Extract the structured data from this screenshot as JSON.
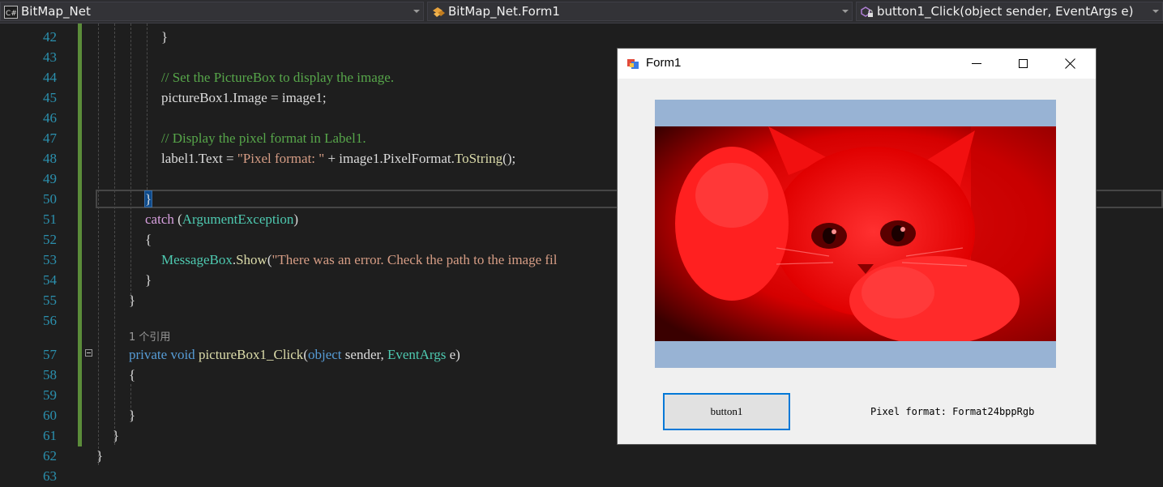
{
  "navigation_bar": {
    "project": {
      "label": "BitMap_Net",
      "icon": "csharp-project-icon"
    },
    "class": {
      "label": "BitMap_Net.Form1",
      "icon": "class-icon"
    },
    "member": {
      "label": "button1_Click(object sender, EventArgs e)",
      "icon": "method-lock-icon"
    }
  },
  "editor": {
    "line_numbers": [
      "42",
      "43",
      "44",
      "45",
      "46",
      "47",
      "48",
      "49",
      "50",
      "51",
      "52",
      "53",
      "54",
      "55",
      "56",
      "57",
      "58",
      "59",
      "60",
      "61",
      "62",
      "63"
    ],
    "codelens": "1 个引用",
    "code": {
      "l42": "}",
      "l44_comment": "// Set the PictureBox to display the image.",
      "l45": "pictureBox1.Image = image1;",
      "l47_comment": "// Display the pixel format in Label1.",
      "l48_a": "label1.Text = ",
      "l48_str": "\"Pixel format: \"",
      "l48_b": " + image1.PixelFormat.",
      "l48_meth": "ToString",
      "l48_c": "();",
      "l50": "}",
      "l51_kw": "catch",
      "l51_a": " (",
      "l51_type": "ArgumentException",
      "l51_b": ")",
      "l52": "{",
      "l53_type": "MessageBox",
      "l53_a": ".",
      "l53_meth": "Show",
      "l53_b": "(",
      "l53_str": "\"There was an error. Check the path to the image fil",
      "l54": "}",
      "l55": "}",
      "l57_kw1": "private",
      "l57_kw2": "void",
      "l57_meth": "pictureBox1_Click",
      "l57_a": "(",
      "l57_kw3": "object",
      "l57_b": " sender, ",
      "l57_type": "EventArgs",
      "l57_c": " e)",
      "l58": "{",
      "l60": "}",
      "l61": "}",
      "l62": "}"
    }
  },
  "form": {
    "title": "Form1",
    "icon": "form-app-icon",
    "controls": {
      "minimize": "minimize-icon",
      "maximize": "maximize-icon",
      "close": "close-icon"
    },
    "picturebox_content": "red-tinted kitten photo",
    "button_label": "button1",
    "label_text": "Pixel format: Format24bppRgb"
  },
  "colors": {
    "editor_bg": "#1e1e1e",
    "line_number": "#2b91af",
    "keyword": "#569cd6",
    "control_keyword": "#d8a0df",
    "type": "#4ec9b0",
    "string": "#d69d85",
    "comment": "#57a64a",
    "method": "#dcdcaa",
    "change_bar": "#5b8c3a",
    "picturebox_bg": "#98b3d4",
    "image_tint": "#ff0000",
    "button_focus_border": "#0078d7"
  }
}
